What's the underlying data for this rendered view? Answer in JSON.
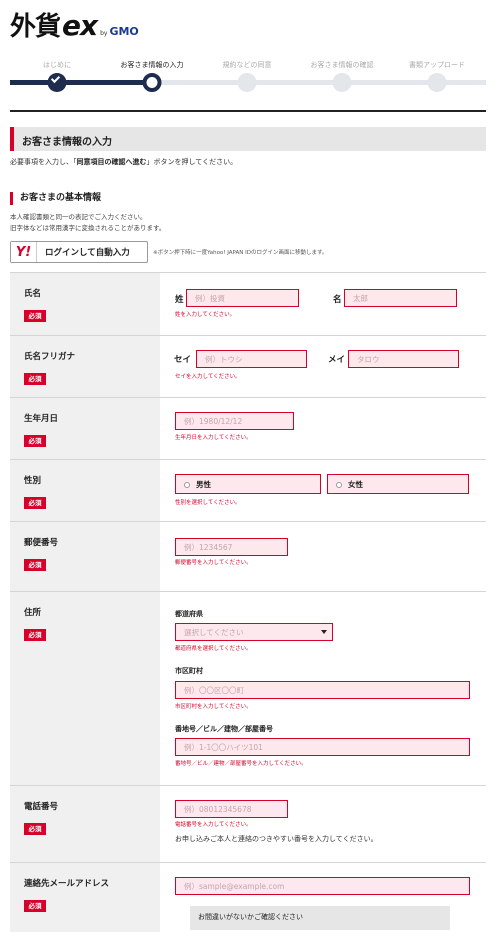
{
  "logo": {
    "main": "外貨",
    "ex": "ex",
    "by": "by",
    "gmo": "GMO"
  },
  "steps": [
    {
      "label": "はじめに",
      "state": "done"
    },
    {
      "label": "お客さま情報の入力",
      "state": "current"
    },
    {
      "label": "規約などの同意",
      "state": "todo"
    },
    {
      "label": "お客さま情報の確認",
      "state": "todo"
    },
    {
      "label": "書類アップロード",
      "state": "todo"
    }
  ],
  "section": {
    "title": "お客さま情報の入力",
    "intro_pre": "必要事項を入力し、「",
    "intro_bold": "同意項目の確認へ進む",
    "intro_post": "」ボタンを押してください。"
  },
  "basic": {
    "title": "お客さまの基本情報",
    "note1": "本人確認書類と同一の表記でご入力ください。",
    "note2": "旧字体などは常用漢字に変換されることがあります。",
    "yahoo_logo": "Y!",
    "yahoo_button": "ログインして自動入力",
    "yahoo_note": "※ボタン押下時に一度Yahoo! JAPAN IDのログイン画面に移動します。"
  },
  "required": "必須",
  "fields": {
    "name": {
      "label": "氏名",
      "sei_label": "姓",
      "sei_placeholder": "例）投資",
      "sei_error": "姓を入力してください。",
      "mei_label": "名",
      "mei_placeholder": "太郎"
    },
    "kana": {
      "label": "氏名フリガナ",
      "sei_label": "セイ",
      "sei_placeholder": "例）トウシ",
      "sei_error": "セイを入力してください。",
      "mei_label": "メイ",
      "mei_placeholder": "タロウ"
    },
    "birth": {
      "label": "生年月日",
      "placeholder": "例）1980/12/12",
      "error": "生年月日を入力してください。"
    },
    "gender": {
      "label": "性別",
      "male": "男性",
      "female": "女性",
      "error": "性別を選択してください。"
    },
    "zip": {
      "label": "郵便番号",
      "placeholder": "例）1234567",
      "error": "郵便番号を入力してください。"
    },
    "address": {
      "label": "住所",
      "pref_label": "都道府県",
      "pref_value": "選択してください",
      "pref_error": "都道府県を選択してください。",
      "city_label": "市区町村",
      "city_placeholder": "例）〇〇区〇〇町",
      "city_error": "市区町村を入力してください。",
      "street_label": "番地号／ビル／建物／部屋番号",
      "street_placeholder": "例）1-1〇〇ハイツ101",
      "street_error": "番地号／ビル／建物／部屋番号を入力してください。"
    },
    "phone": {
      "label": "電話番号",
      "placeholder": "例）08012345678",
      "error": "電話番号を入力してください。",
      "hint": "お申し込みご本人と連絡のつきやすい番号を入力してください。"
    },
    "email": {
      "label": "連絡先メールアドレス",
      "placeholder": "例）sample@example.com",
      "confirm": "お間違いがないかご確認ください"
    }
  }
}
